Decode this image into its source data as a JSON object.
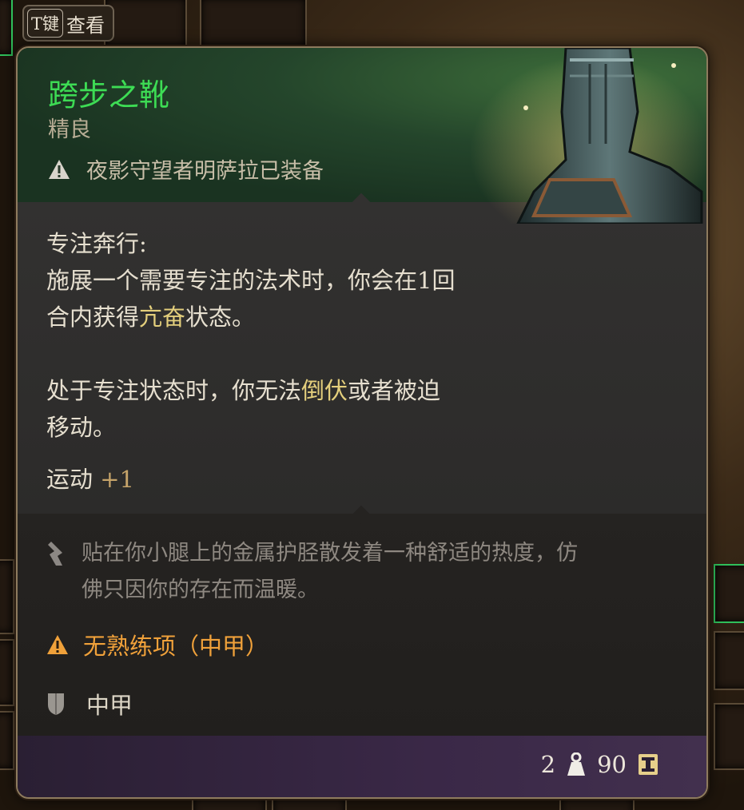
{
  "hint": {
    "key": "T键",
    "label": "查看"
  },
  "item": {
    "name": "跨步之靴",
    "rarity": "精良",
    "equipped_by": "夜影守望者明萨拉已装备",
    "ability_title": "专注奔行:",
    "ability_line1": "施展一个需要专注的法术时，你会在1回",
    "ability_line2_pre": "合内获得",
    "ability_line2_hl": "亢奋",
    "ability_line2_post": "状态。",
    "ability_line3_pre": "处于专注状态时，你无法",
    "ability_line3_hl": "倒伏",
    "ability_line3_post": "或者被迫",
    "ability_line4": "移动。",
    "stat_name": "运动",
    "stat_value": "+1",
    "flavor_line1": "贴在你小腿上的金属护胫散发着一种舒适的热度，仿",
    "flavor_line2": "佛只因你的存在而温暖。",
    "proficiency": "无熟练项（中甲）",
    "armor_type": "中甲",
    "weight": "2",
    "value": "90"
  },
  "colors": {
    "title_green": "#3ddc54",
    "highlight": "#e4cf7c",
    "warning_orange": "#f0a13a",
    "footer_purple": "#3a2847"
  },
  "icons": [
    "warning-icon",
    "quill-icon",
    "shield-icon",
    "weight-icon",
    "gold-icon"
  ]
}
